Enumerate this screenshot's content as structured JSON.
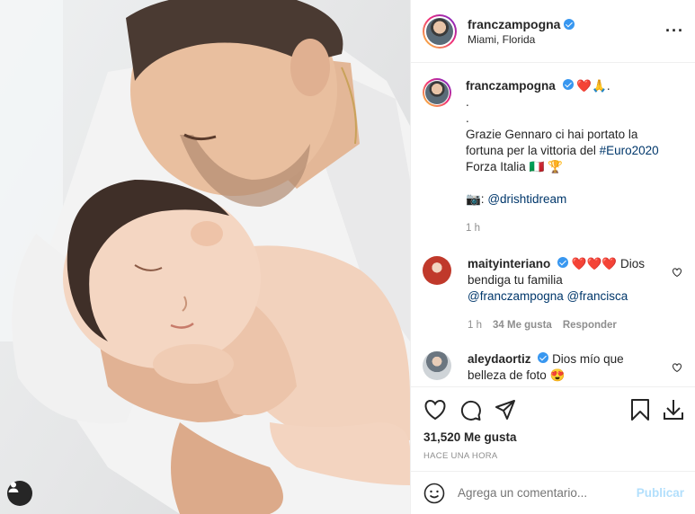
{
  "post": {
    "author": "franczampogna",
    "location": "Miami, Florida",
    "caption": {
      "username": "franczampogna",
      "emojis": "❤️🙏.",
      "dot1": ".",
      "dot2": ".",
      "text_line1": "Grazie Gennaro ci hai portato la",
      "text_line2_prefix": "fortuna per la vittoria del ",
      "hashtag": "#Euro2020",
      "text_line3": "Forza Italia 🇮🇹 🏆",
      "credit_prefix": "📷: ",
      "credit_mention": "@drishtidream",
      "time": "1 h"
    },
    "comments": [
      {
        "username": "maityinteriano",
        "text_start": "❤️❤️❤️ Dios",
        "text_line2": "bendiga tu familia",
        "mention1": "@franczampogna",
        "mention2": "@francisca",
        "time": "1 h",
        "likes": "34 Me gusta",
        "reply": "Responder",
        "avatar_color": "#c0392b"
      },
      {
        "username": "aleydaortiz",
        "text_start": "Dios mío que",
        "text_line2": "belleza de foto 😍",
        "avatar_color": "#4a5560"
      }
    ],
    "likes_count": "31,520 Me gusta",
    "timestamp": "HACE UNA HORA",
    "comment_placeholder": "Agrega un comentario...",
    "publish_label": "Publicar"
  },
  "colors": {
    "accent_blue": "#3897f0",
    "mention_blue": "#00376b",
    "muted": "#8e8e8e",
    "publish_disabled": "#b2dffc"
  },
  "icons": {
    "more": "more-options-icon",
    "like": "heart-icon",
    "comment": "comment-bubble-icon",
    "share": "paper-plane-icon",
    "save": "bookmark-icon",
    "download": "download-icon",
    "emoji": "smiley-icon",
    "user_tag": "user-tag-icon"
  }
}
